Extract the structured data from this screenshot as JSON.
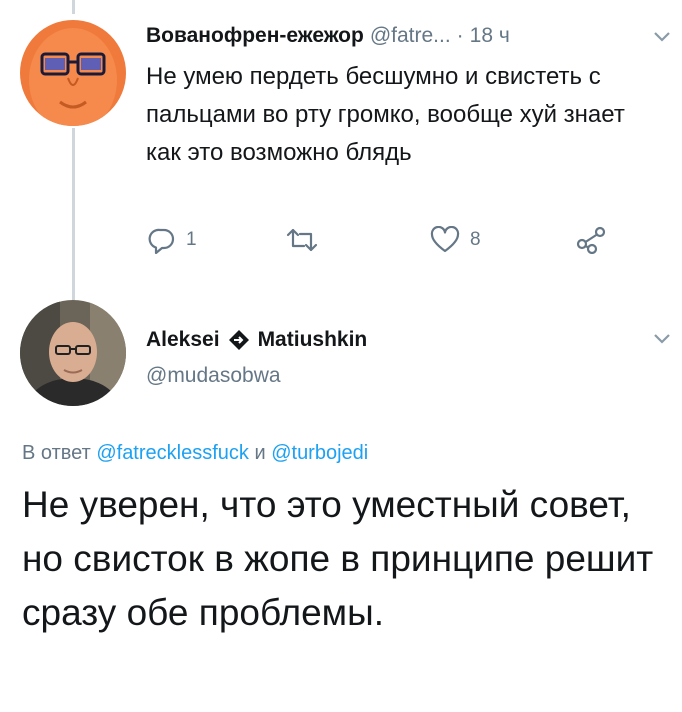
{
  "tweet1": {
    "author_name": "Вованофрен-ежежор",
    "handle": "@fatre...",
    "separator": "·",
    "time": "18 ч",
    "text": "Не умею пердеть бесшумно и свистеть с пальцами во рту громко, вообще хуй знает как это возможно блядь",
    "actions": {
      "reply_count": "1",
      "retweet_count": "",
      "like_count": "8"
    }
  },
  "tweet2": {
    "author_first": "Aleksei",
    "author_last": "Matiushkin",
    "handle": "@mudasobwa",
    "reply_prefix": "В ответ",
    "reply_user1": "@fatrecklessfuck",
    "reply_conj": "и",
    "reply_user2": "@turbojedi",
    "text": "Не уверен, что это уместный совет, но свисток в жопе в принципе решит сразу обе проблемы."
  },
  "colors": {
    "text": "#14171a",
    "secondary": "#657786",
    "link": "#1da1f2",
    "thread_line": "#cfd6dc",
    "avatar1_bg": "#f07a3c"
  },
  "icons": [
    "reply-icon",
    "retweet-icon",
    "like-icon",
    "share-icon",
    "chevron-down-icon",
    "diamond-icon"
  ]
}
